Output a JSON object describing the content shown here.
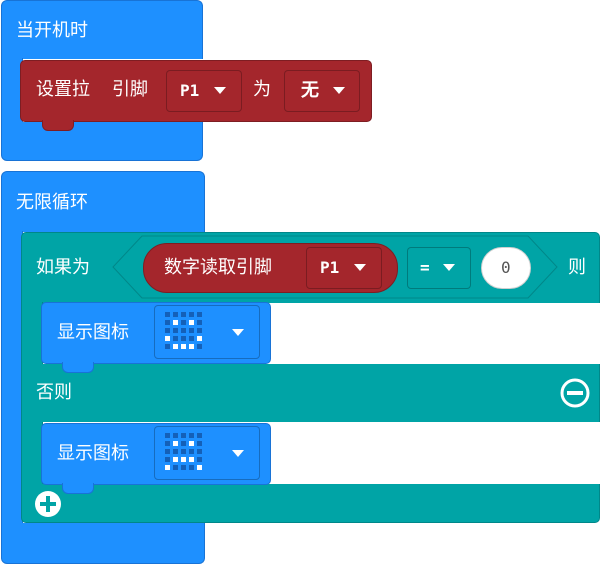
{
  "on_start": {
    "label": "当开机时",
    "pull_block": {
      "label_set": "设置拉",
      "label_pin": "引脚",
      "pin_value": "P1",
      "label_to": "为",
      "mode_value": "无"
    }
  },
  "forever": {
    "label": "无限循环",
    "if_block": {
      "label_if": "如果为",
      "label_then": "则",
      "label_else": "否则",
      "condition": {
        "read_label": "数字读取引脚",
        "pin_value": "P1",
        "operator": "=",
        "compare_value": "0"
      },
      "then_action": {
        "label": "显示图标",
        "icon": "happy-face-icon"
      },
      "else_action": {
        "label": "显示图标",
        "icon": "sad-face-icon"
      }
    }
  },
  "colors": {
    "basic_blue": "#1e90ff",
    "pins_red": "#a4262c",
    "logic_teal": "#00a4a6",
    "workspace": "#ffffff"
  },
  "icons": {
    "dropdown": "chevron-down-icon",
    "remove_else": "minus-circle-icon",
    "add_else": "plus-circle-icon",
    "happy": {
      "name": "happy-face-icon",
      "leds": [
        [
          0,
          0,
          0,
          0,
          0
        ],
        [
          0,
          1,
          0,
          1,
          0
        ],
        [
          0,
          0,
          0,
          0,
          0
        ],
        [
          1,
          0,
          0,
          0,
          1
        ],
        [
          0,
          1,
          1,
          1,
          0
        ]
      ]
    },
    "sad": {
      "name": "sad-face-icon",
      "leds": [
        [
          0,
          0,
          0,
          0,
          0
        ],
        [
          0,
          1,
          0,
          1,
          0
        ],
        [
          0,
          0,
          0,
          0,
          0
        ],
        [
          0,
          1,
          1,
          1,
          0
        ],
        [
          1,
          0,
          0,
          0,
          1
        ]
      ]
    }
  }
}
